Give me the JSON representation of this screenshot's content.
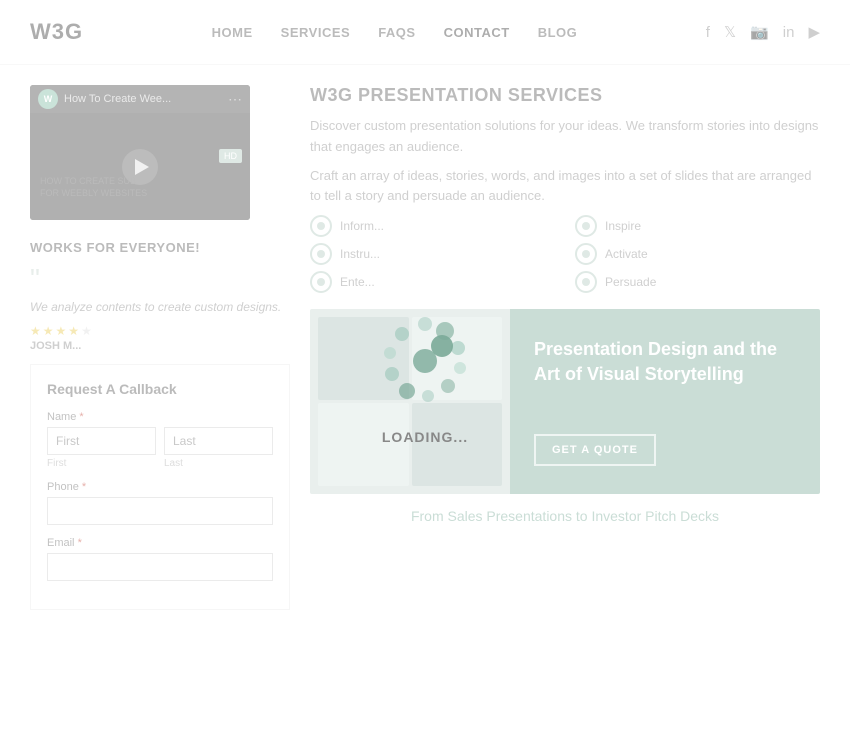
{
  "header": {
    "logo": "W3G",
    "nav": {
      "items": [
        {
          "label": "HOME",
          "active": false
        },
        {
          "label": "SERVICES",
          "active": false
        },
        {
          "label": "FAQS",
          "active": false
        },
        {
          "label": "CONTACT",
          "active": true
        },
        {
          "label": "BLOG",
          "active": false
        }
      ]
    },
    "social": [
      "facebook",
      "twitter",
      "instagram",
      "linkedin",
      "youtube"
    ]
  },
  "video": {
    "icon_text": "W",
    "title": "How To Create Wee...",
    "label": "HD"
  },
  "works": {
    "title": "WORKS FOR EVERYONE!",
    "testimonial": "We analyze contents to create custom designs.",
    "reviewer": "JOSH M...",
    "stars": 4
  },
  "callback_form": {
    "title": "Request A Callback",
    "name_label": "Name",
    "required_mark": "*",
    "first_placeholder": "First",
    "last_placeholder": "Last",
    "first_sublabel": "First",
    "last_sublabel": "Last",
    "phone_label": "Phone",
    "email_label": "Email"
  },
  "services": {
    "title": "W3G PRESENTATION SERVICES",
    "desc1": "Discover custom presentation solutions for your ideas. We transform stories into designs that engages an audience.",
    "desc2": "Craft an array of ideas, stories, words, and images into a set of slides that are arranged to tell a story and persuade an audience.",
    "features": [
      {
        "label": "Inform..."
      },
      {
        "label": "Inspire"
      },
      {
        "label": "Instru..."
      },
      {
        "label": "Activate"
      },
      {
        "label": "Ente..."
      },
      {
        "label": "Persuade"
      }
    ]
  },
  "card": {
    "title": "Presentation Design and the Art of Visual Storytelling",
    "button_label": "GET A QUOTE"
  },
  "bottom": {
    "text": "From Sales Presentations to Investor Pitch Decks"
  },
  "loading": {
    "text": "LOADING..."
  }
}
